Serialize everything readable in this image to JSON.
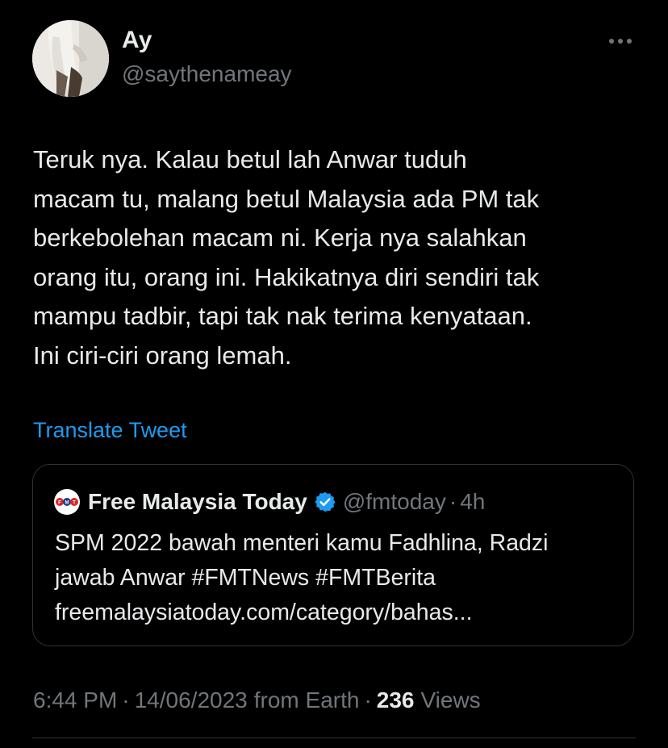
{
  "author": {
    "display_name": "Ay",
    "handle": "@saythenameay"
  },
  "icons": {
    "more": "more-horizontal-icon",
    "verified": "verified-badge-icon",
    "quote_logo": "fmt-logo-icon"
  },
  "tweet": {
    "text": "Teruk nya. Kalau betul lah Anwar tuduh\nmacam tu, malang betul Malaysia ada PM tak\nberkebolehan macam ni. Kerja nya salahkan\norang itu, orang ini. Hakikatnya diri sendiri tak\nmampu tadbir, tapi tak nak terima kenyataan.\nIni ciri-ciri orang lemah.",
    "translate_label": "Translate Tweet"
  },
  "quote": {
    "logo_text": "FMT",
    "name": "Free Malaysia Today",
    "handle": "@fmtoday",
    "separator": "·",
    "time": "4h",
    "text": "SPM 2022 bawah menteri kamu Fadhlina, Radzi\njawab Anwar #FMTNews #FMTBerita\nfreemalaysiatoday.com/category/bahas..."
  },
  "meta": {
    "time": "6:44 PM",
    "sep1": "·",
    "date": "14/06/2023",
    "source": "from Earth",
    "sep2": "·",
    "views_count": "236",
    "views_label": "Views"
  },
  "colors": {
    "background": "#000000",
    "text_primary": "#e7e9ea",
    "text_secondary": "#71767b",
    "link": "#1d9bf0",
    "border": "#2f3336",
    "verified": "#1d9bf0"
  }
}
